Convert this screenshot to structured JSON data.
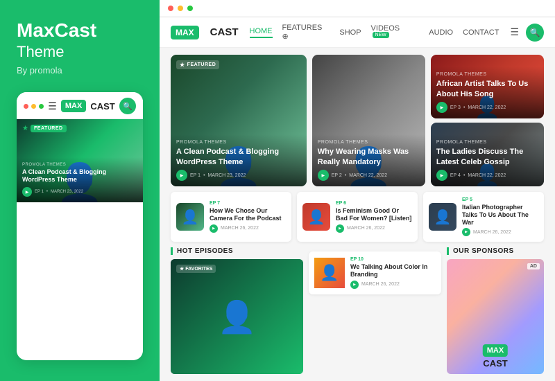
{
  "leftPanel": {
    "brandTitle": "MaxCast",
    "brandSubtitle": "Theme",
    "brandBy": "By promola"
  },
  "mobileMockup": {
    "logoText": "MAXCAST",
    "logoBadge": "MAX",
    "featuredBadge": "FEATURED",
    "cardTag": "PROMOLA THEMES",
    "cardTitle": "A Clean Podcast & Blogging WordPress Theme",
    "metaEp": "EP 1",
    "metaDate": "MARCH 23, 2022"
  },
  "siteNav": {
    "logoBadge": "MAX",
    "logoText": "CAST",
    "links": [
      {
        "label": "HOME",
        "active": true
      },
      {
        "label": "FEATURES ⊕",
        "active": false
      },
      {
        "label": "SHOP",
        "active": false
      },
      {
        "label": "VIDEOS",
        "active": false,
        "badge": "NEW"
      },
      {
        "label": "AUDIO",
        "active": false
      },
      {
        "label": "CONTACT",
        "active": false
      }
    ]
  },
  "featuredCards": [
    {
      "tag": "PROMOLA THEMES",
      "title": "A Clean Podcast & Blogging WordPress Theme",
      "ep": "EP 1",
      "date": "MARCH 23, 2022",
      "featured": true
    },
    {
      "tag": "PROMOLA THEMES",
      "title": "Why Wearing Masks Was Really Mandatory",
      "ep": "EP 2",
      "date": "MARCH 22, 2022"
    },
    {
      "tag": "PROMOLA THEMES",
      "title": "African Artist Talks To Us About His Song",
      "ep": "EP 3",
      "date": "MARCH 22, 2022"
    },
    {
      "tag": "PROMOLA THEMES",
      "title": "The Ladies Discuss The Latest Celeb Gossip",
      "ep": "EP 4",
      "date": "MARCH 22, 2022"
    }
  ],
  "podcastItems": [
    {
      "ep": "EP 7",
      "title": "How We Chose Our Camera For the Podcast",
      "date": "MARCH 26, 2022",
      "epNum": "7"
    },
    {
      "ep": "EP 6",
      "title": "Is Feminism Good Or Bad For Women? [Listen]",
      "date": "MARCH 26, 2022",
      "epNum": "6"
    },
    {
      "ep": "EP 5",
      "title": "Italian Photographer Talks To Us About The War",
      "date": "MARCH 26, 2022",
      "epNum": "5"
    }
  ],
  "hotEpisodes": {
    "title": "HOT EPISODES",
    "favoritesBadge": "★ FAVORITES",
    "ep10": {
      "ep": "EP 10",
      "title": "We Talking About Color In Branding",
      "date": "MARCH 26, 2022"
    }
  },
  "sponsors": {
    "title": "OUR SPONSORS",
    "adBadge": "AD",
    "logoBadge": "MAX",
    "logoText": "CAST"
  }
}
